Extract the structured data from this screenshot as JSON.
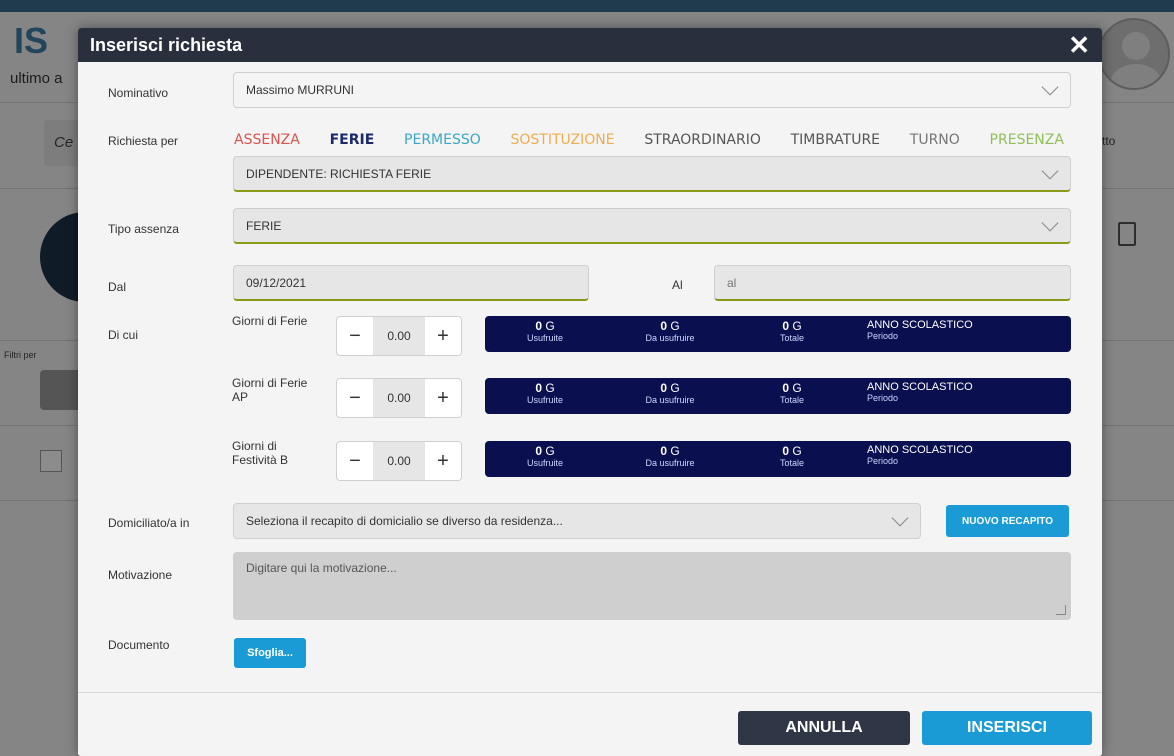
{
  "background": {
    "logo": "IS",
    "user_text": "ultimo a",
    "search_text": "Ce",
    "filters_text": "Filtri per",
    "right_text": "tto"
  },
  "modal": {
    "title": "Inserisci richiesta",
    "close_icon": "close-icon"
  },
  "form": {
    "nominativo_label": "Nominativo",
    "nominativo_value": "Massimo MURRUNI",
    "richiesta_label": "Richiesta per",
    "tabs": [
      {
        "label": "ASSENZA",
        "color": "#d9534f",
        "active": false
      },
      {
        "label": "FERIE",
        "color": "#1a2a6c",
        "active": true
      },
      {
        "label": "PERMESSO",
        "color": "#3aa6c9",
        "active": false
      },
      {
        "label": "SOSTITUZIONE",
        "color": "#f0ad4e",
        "active": false
      },
      {
        "label": "STRAORDINARIO",
        "color": "#555555",
        "active": false
      },
      {
        "label": "TIMBRATURE",
        "color": "#555555",
        "active": false
      },
      {
        "label": "TURNO",
        "color": "#777777",
        "active": false
      },
      {
        "label": "PRESENZA",
        "color": "#8fbf5a",
        "active": false
      }
    ],
    "richiesta_value": "DIPENDENTE: RICHIESTA FERIE",
    "tipo_label": "Tipo assenza",
    "tipo_value": "FERIE",
    "dal_label": "Dal",
    "dal_value": "09/12/2021",
    "al_label": "Al",
    "al_placeholder": "al",
    "dicui_label": "Di cui",
    "rows": [
      {
        "label": "Giorni di Ferie",
        "value": "0.00",
        "usufruite": "0",
        "da_usufruire": "0",
        "totale": "0",
        "unit": "G",
        "usufruite_label": "Usufruite",
        "da_usufruire_label": "Da usufruire",
        "totale_label": "Totale",
        "period_title": "ANNO SCOLASTICO",
        "period_label": "Periodo"
      },
      {
        "label": "Giorni di Ferie AP",
        "value": "0.00",
        "usufruite": "0",
        "da_usufruire": "0",
        "totale": "0",
        "unit": "G",
        "usufruite_label": "Usufruite",
        "da_usufruire_label": "Da usufruire",
        "totale_label": "Totale",
        "period_title": "ANNO SCOLASTICO",
        "period_label": "Periodo"
      },
      {
        "label": "Giorni di Festività B",
        "value": "0.00",
        "usufruite": "0",
        "da_usufruire": "0",
        "totale": "0",
        "unit": "G",
        "usufruite_label": "Usufruite",
        "da_usufruire_label": "Da usufruire",
        "totale_label": "Totale",
        "period_title": "ANNO SCOLASTICO",
        "period_label": "Periodo"
      }
    ],
    "domicilio_label": "Domiciliato/a in",
    "domicilio_placeholder": "Seleziona il recapito di domicialio se diverso da residenza...",
    "nuovo_recapito": "NUOVO RECAPITO",
    "motivazione_label": "Motivazione",
    "motivazione_placeholder": "Digitare qui la motivazione...",
    "documento_label": "Documento",
    "sfoglia": "Sfoglia..."
  },
  "footer": {
    "annulla": "ANNULLA",
    "inserisci": "INSERISCI"
  }
}
